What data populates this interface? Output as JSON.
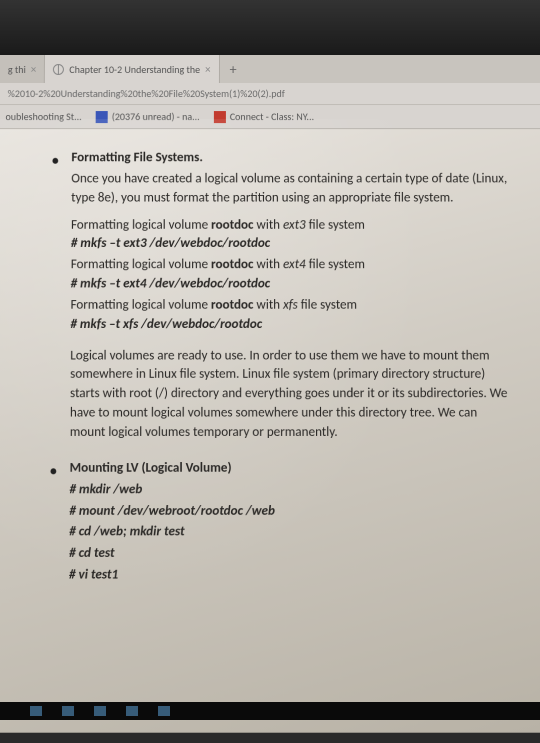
{
  "tabs": [
    {
      "label": "g thi"
    },
    {
      "label": "Chapter 10-2 Understanding the"
    }
  ],
  "url": "%2010-2%20Understanding%20the%20File%20System(1)%20(2).pdf",
  "bookmarks": [
    {
      "label": "oubleshooting St..."
    },
    {
      "label": "(20376 unread) - na..."
    },
    {
      "label": "Connect - Class: NY..."
    }
  ],
  "doc": {
    "section1": {
      "title": "Formatting File Systems.",
      "intro": "Once you have created a logical volume as containing a certain type of date (Linux, type 8e), you must format the partition using an appropriate file system.",
      "fmt1_pre": "Formatting logical volume ",
      "fmt1_vol": "rootdoc",
      "fmt1_mid": " with ",
      "fmt1_fs": "ext3",
      "fmt1_post": " file system",
      "cmd1": "# mkfs –t ext3 /dev/webdoc/rootdoc",
      "fmt2_pre": "Formatting logical volume ",
      "fmt2_vol": "rootdoc",
      "fmt2_mid": " with ",
      "fmt2_fs": "ext4",
      "fmt2_post": " file system",
      "cmd2": "# mkfs –t ext4 /dev/webdoc/rootdoc",
      "fmt3_pre": "Formatting logical volume ",
      "fmt3_vol": "rootdoc",
      "fmt3_mid": " with ",
      "fmt3_fs": "xfs",
      "fmt3_post": " file system",
      "cmd3": "# mkfs –t xfs /dev/webdoc/rootdoc",
      "para2": "Logical volumes are ready to use. In order to use them we have to mount them somewhere in Linux file system. Linux file system (primary directory structure) starts with root (/) directory and everything goes under it or its subdirectories. We have to mount logical volumes somewhere under this directory tree. We can mount logical volumes temporary or permanently."
    },
    "section2": {
      "title": "Mounting LV (Logical Volume)",
      "c1": "# mkdir /web",
      "c2": "# mount /dev/webroot/rootdoc /web",
      "c3": "# cd /web; mkdir test",
      "c4": "# cd test",
      "c5": "# vi test1"
    }
  }
}
